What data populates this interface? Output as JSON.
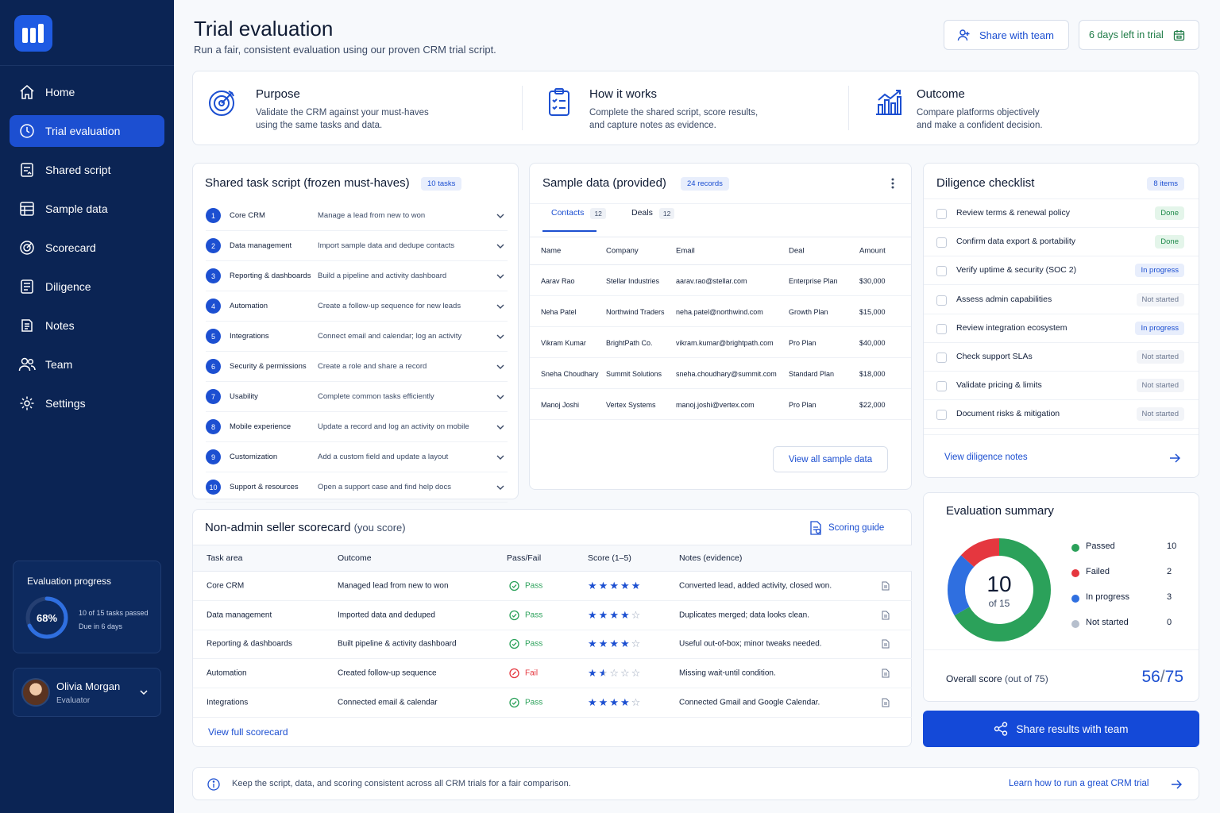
{
  "sidebar": {
    "items": [
      {
        "label": "Home",
        "icon": "home-icon"
      },
      {
        "label": "Trial evaluation",
        "icon": "clock-icon"
      },
      {
        "label": "Shared script",
        "icon": "script-icon"
      },
      {
        "label": "Sample data",
        "icon": "table-icon"
      },
      {
        "label": "Scorecard",
        "icon": "target-icon"
      },
      {
        "label": "Diligence",
        "icon": "document-icon"
      },
      {
        "label": "Notes",
        "icon": "notes-icon"
      },
      {
        "label": "Team",
        "icon": "team-icon"
      },
      {
        "label": "Settings",
        "icon": "gear-icon"
      }
    ],
    "progress": {
      "title": "Evaluation progress",
      "percent_label": "68%",
      "percent": 68,
      "tasks_text": "10 of 15 tasks passed",
      "due_text": "Due in 6 days"
    },
    "user": {
      "name": "Olivia Morgan",
      "role": "Evaluator"
    }
  },
  "header": {
    "title": "Trial evaluation",
    "subtitle": "Run a fair, consistent evaluation using our proven CRM trial script.",
    "share_label": "Share with team",
    "trial_label": "6 days left in trial"
  },
  "info": [
    {
      "title": "Purpose",
      "line1": "Validate the CRM against your must-haves",
      "line2": "using the same tasks and data."
    },
    {
      "title": "How it works",
      "line1": "Complete the shared script, score results,",
      "line2": "and capture notes as evidence."
    },
    {
      "title": "Outcome",
      "line1": "Compare platforms objectively",
      "line2": "and make a confident decision."
    }
  ],
  "script": {
    "title": "Shared task script (frozen must-haves)",
    "badge": "10 tasks",
    "tasks": [
      {
        "num": "1",
        "area": "Core CRM",
        "desc": "Manage a lead from new to won"
      },
      {
        "num": "2",
        "area": "Data management",
        "desc": "Import sample data and dedupe contacts"
      },
      {
        "num": "3",
        "area": "Reporting & dashboards",
        "desc": "Build a pipeline and activity dashboard"
      },
      {
        "num": "4",
        "area": "Automation",
        "desc": "Create a follow-up sequence for new leads"
      },
      {
        "num": "5",
        "area": "Integrations",
        "desc": "Connect email and calendar; log an activity"
      },
      {
        "num": "6",
        "area": "Security & permissions",
        "desc": "Create a role and share a record"
      },
      {
        "num": "7",
        "area": "Usability",
        "desc": "Complete common tasks efficiently"
      },
      {
        "num": "8",
        "area": "Mobile experience",
        "desc": "Update a record and log an activity on mobile"
      },
      {
        "num": "9",
        "area": "Customization",
        "desc": "Add a custom field and update a layout"
      },
      {
        "num": "10",
        "area": "Support & resources",
        "desc": "Open a support case and find help docs"
      }
    ]
  },
  "sample": {
    "title": "Sample data (provided)",
    "badge": "24 records",
    "tabs": [
      {
        "label": "Contacts",
        "count": "12"
      },
      {
        "label": "Deals",
        "count": "12"
      }
    ],
    "columns": [
      "Name",
      "Company",
      "Email",
      "Deal",
      "Amount"
    ],
    "rows": [
      [
        "Aarav Rao",
        "Stellar Industries",
        "aarav.rao@stellar.com",
        "Enterprise Plan",
        "$30,000"
      ],
      [
        "Neha Patel",
        "Northwind Traders",
        "neha.patel@northwind.com",
        "Growth Plan",
        "$15,000"
      ],
      [
        "Vikram Kumar",
        "BrightPath Co.",
        "vikram.kumar@brightpath.com",
        "Pro Plan",
        "$40,000"
      ],
      [
        "Sneha Choudhary",
        "Summit Solutions",
        "sneha.choudhary@summit.com",
        "Standard Plan",
        "$18,000"
      ],
      [
        "Manoj Joshi",
        "Vertex Systems",
        "manoj.joshi@vertex.com",
        "Pro Plan",
        "$22,000"
      ]
    ],
    "view_all": "View all sample data"
  },
  "diligence": {
    "title": "Diligence checklist",
    "badge": "8 items",
    "items": [
      {
        "label": "Review terms & renewal policy",
        "status": "Done",
        "kind": "done"
      },
      {
        "label": "Confirm data export & portability",
        "status": "Done",
        "kind": "done"
      },
      {
        "label": "Verify uptime & security (SOC 2)",
        "status": "In progress",
        "kind": "prog"
      },
      {
        "label": "Assess admin capabilities",
        "status": "Not started",
        "kind": "not"
      },
      {
        "label": "Review integration ecosystem",
        "status": "In progress",
        "kind": "prog"
      },
      {
        "label": "Check support SLAs",
        "status": "Not started",
        "kind": "not"
      },
      {
        "label": "Validate pricing & limits",
        "status": "Not started",
        "kind": "not"
      },
      {
        "label": "Document risks & mitigation",
        "status": "Not started",
        "kind": "not"
      }
    ],
    "notes_link": "View diligence notes"
  },
  "scorecard": {
    "title": "Non-admin seller scorecard",
    "title_suffix": "(you score)",
    "guide": "Scoring guide",
    "columns": [
      "Task area",
      "Outcome",
      "Pass/Fail",
      "Score (1–5)",
      "Notes (evidence)"
    ],
    "rows": [
      {
        "area": "Core CRM",
        "outcome": "Managed lead from new to won",
        "result": "Pass",
        "score": 5,
        "notes": "Converted lead, added activity, closed won."
      },
      {
        "area": "Data management",
        "outcome": "Imported data and deduped",
        "result": "Pass",
        "score": 4,
        "notes": "Duplicates merged; data looks clean."
      },
      {
        "area": "Reporting & dashboards",
        "outcome": "Built pipeline & activity dashboard",
        "result": "Pass",
        "score": 4,
        "notes": "Useful out-of-box; minor tweaks needed."
      },
      {
        "area": "Automation",
        "outcome": "Created follow-up sequence",
        "result": "Fail",
        "score": 1.5,
        "notes": "Missing wait-until condition."
      },
      {
        "area": "Integrations",
        "outcome": "Connected email & calendar",
        "result": "Pass",
        "score": 4,
        "notes": "Connected Gmail and Google Calendar."
      }
    ],
    "view_full": "View full scorecard"
  },
  "summary": {
    "title": "Evaluation summary",
    "center_value": "10",
    "center_sub": "of 15",
    "legend": [
      {
        "label": "Passed",
        "value": 10,
        "color": "#2ba15a"
      },
      {
        "label": "Failed",
        "value": 2,
        "color": "#e5373f"
      },
      {
        "label": "In progress",
        "value": 3,
        "color": "#2f6fe0"
      },
      {
        "label": "Not started",
        "value": 0,
        "color": "#b6bfcd"
      }
    ],
    "overall_label": "Overall score",
    "overall_suffix": "(out of 75)",
    "score": "56",
    "score_total": "75"
  },
  "share_results": "Share results with team",
  "banner": {
    "text": "Keep the script, data, and scoring consistent across all CRM trials for a fair comparison.",
    "link": "Learn how to run a great CRM trial"
  },
  "colors": {
    "sidebar": "#0b2454",
    "accent": "#1c4fd1",
    "pass": "#2ba15a",
    "fail": "#e5373f"
  }
}
